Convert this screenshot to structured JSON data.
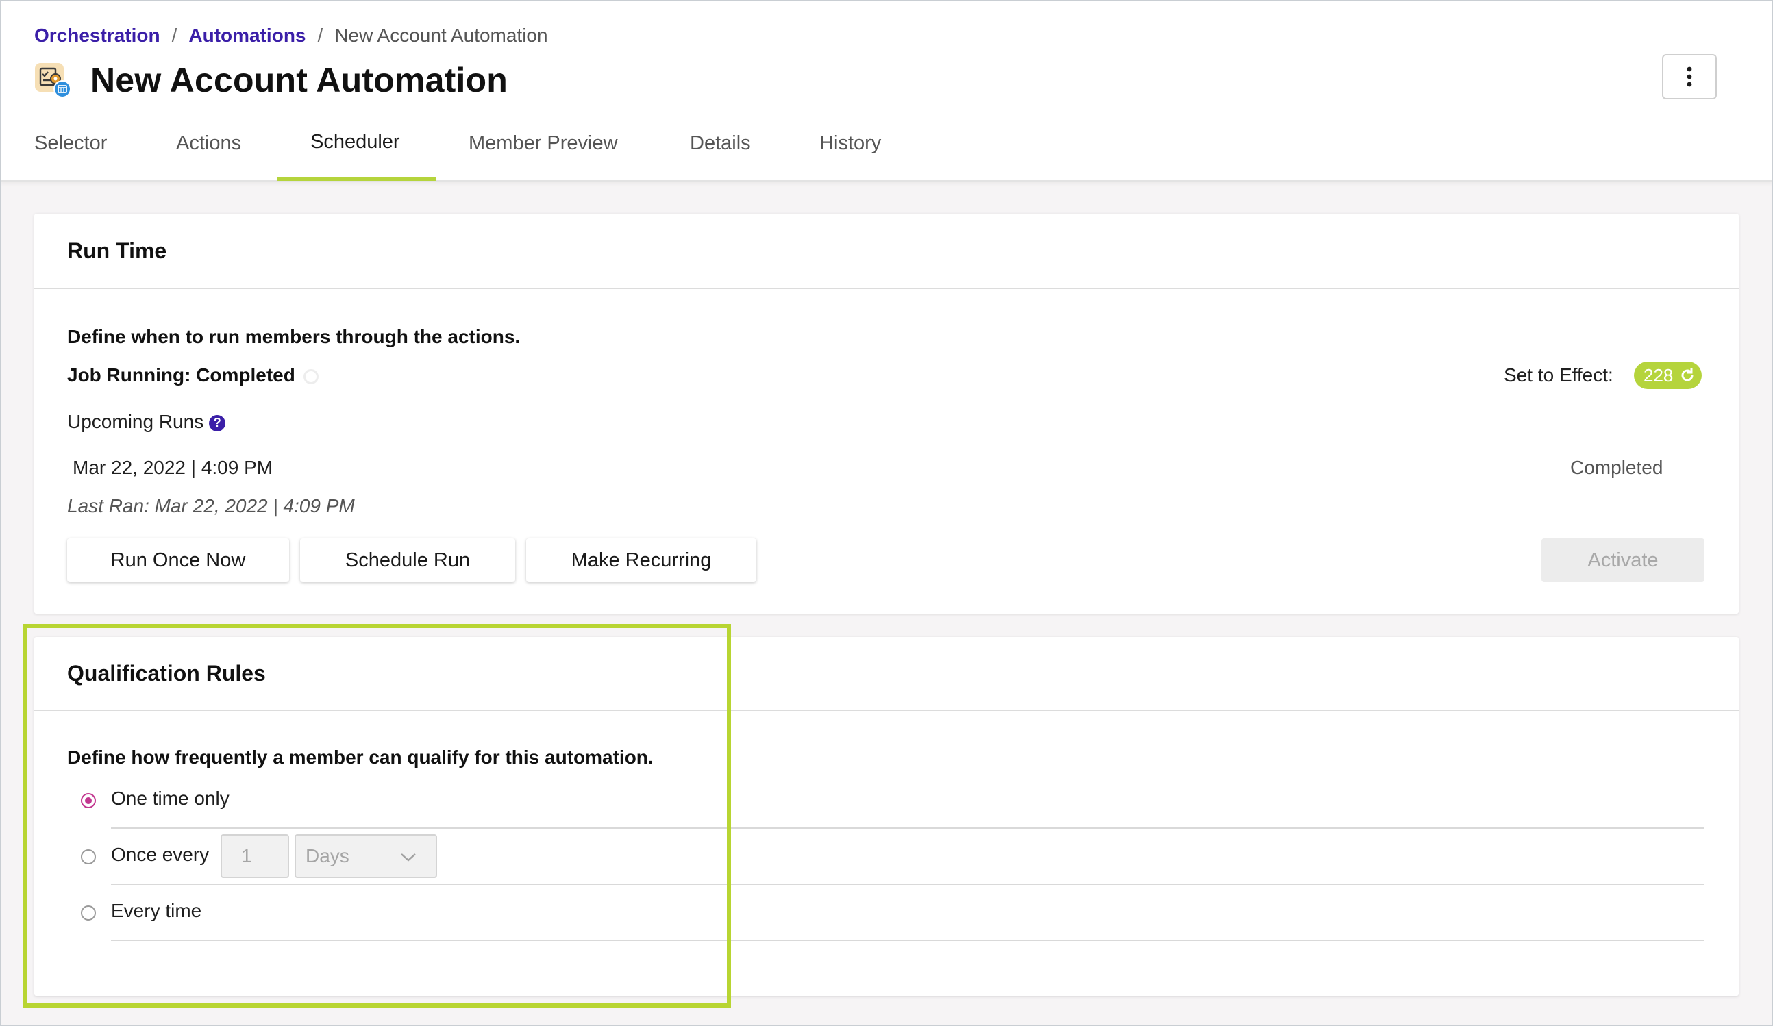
{
  "breadcrumb": {
    "items": [
      "Orchestration",
      "Automations"
    ],
    "current": "New Account Automation",
    "separator": "/"
  },
  "page": {
    "title": "New Account Automation",
    "more_icon": "kebab-menu-icon"
  },
  "tabs": [
    {
      "label": "Selector"
    },
    {
      "label": "Actions"
    },
    {
      "label": "Scheduler",
      "active": true
    },
    {
      "label": "Member Preview"
    },
    {
      "label": "Details"
    },
    {
      "label": "History"
    }
  ],
  "run_time": {
    "title": "Run Time",
    "description": "Define when to run members through the actions.",
    "job_status": "Job Running: Completed",
    "set_to_effect_label": "Set to Effect:",
    "set_to_effect_count": "228",
    "upcoming_runs_label": "Upcoming Runs",
    "help_glyph": "?",
    "upcoming_run": "Mar 22, 2022 | 4:09 PM",
    "upcoming_status": "Completed",
    "last_ran": "Last Ran: Mar 22, 2022 | 4:09 PM",
    "buttons": {
      "run_once": "Run Once Now",
      "schedule": "Schedule Run",
      "recurring": "Make Recurring",
      "activate": "Activate"
    }
  },
  "qualification": {
    "title": "Qualification Rules",
    "description": "Define how frequently a member can qualify for this automation.",
    "options": [
      {
        "label": "One time only",
        "selected": true
      },
      {
        "label": "Once every",
        "selected": false
      },
      {
        "label": "Every time",
        "selected": false
      }
    ],
    "interval_value": "1",
    "interval_unit": "Days"
  },
  "colors": {
    "brand_link": "#3b1fa8",
    "accent_green": "#b5d43c",
    "radio_selected": "#c2368f"
  }
}
